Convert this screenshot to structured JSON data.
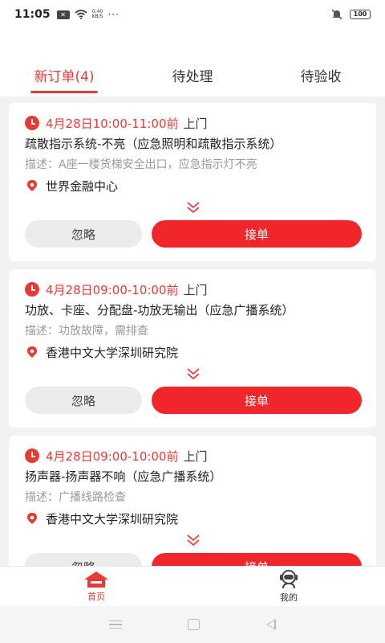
{
  "status_bar": {
    "time": "11:05",
    "net_speed_value": "0.40",
    "net_speed_unit": "KB/S",
    "dots": "···",
    "battery": "100",
    "icons": [
      "notification-x-icon",
      "wifi-icon",
      "mute-icon",
      "battery-icon"
    ]
  },
  "tabs": [
    {
      "label": "新订单(4)",
      "active": true
    },
    {
      "label": "待处理",
      "active": false
    },
    {
      "label": "待验收",
      "active": false
    }
  ],
  "orders": [
    {
      "time": "4月28日10:00-11:00前",
      "visit": "上门",
      "title": "疏散指示系统-不亮（应急照明和疏散指示系统）",
      "desc": "描述：A座一楼货梯安全出口，应急指示灯不亮",
      "location": "世界金融中心",
      "ignore_label": "忽略",
      "accept_label": "接单"
    },
    {
      "time": "4月28日09:00-10:00前",
      "visit": "上门",
      "title": "功放、卡座、分配盘-功放无输出（应急广播系统）",
      "desc": "描述：功放故障，需排查",
      "location": "香港中文大学深圳研究院",
      "ignore_label": "忽略",
      "accept_label": "接单"
    },
    {
      "time": "4月28日09:00-10:00前",
      "visit": "上门",
      "title": "扬声器-扬声器不响（应急广播系统）",
      "desc": "描述：广播线路检查",
      "location": "香港中文大学深圳研究院",
      "ignore_label": "忽略",
      "accept_label": "接单"
    }
  ],
  "tabbar": {
    "home_label": "首页",
    "mine_label": "我的"
  },
  "colors": {
    "accent": "#e83a34",
    "accept_button": "#f0262a",
    "ignore_button": "#ececec"
  }
}
